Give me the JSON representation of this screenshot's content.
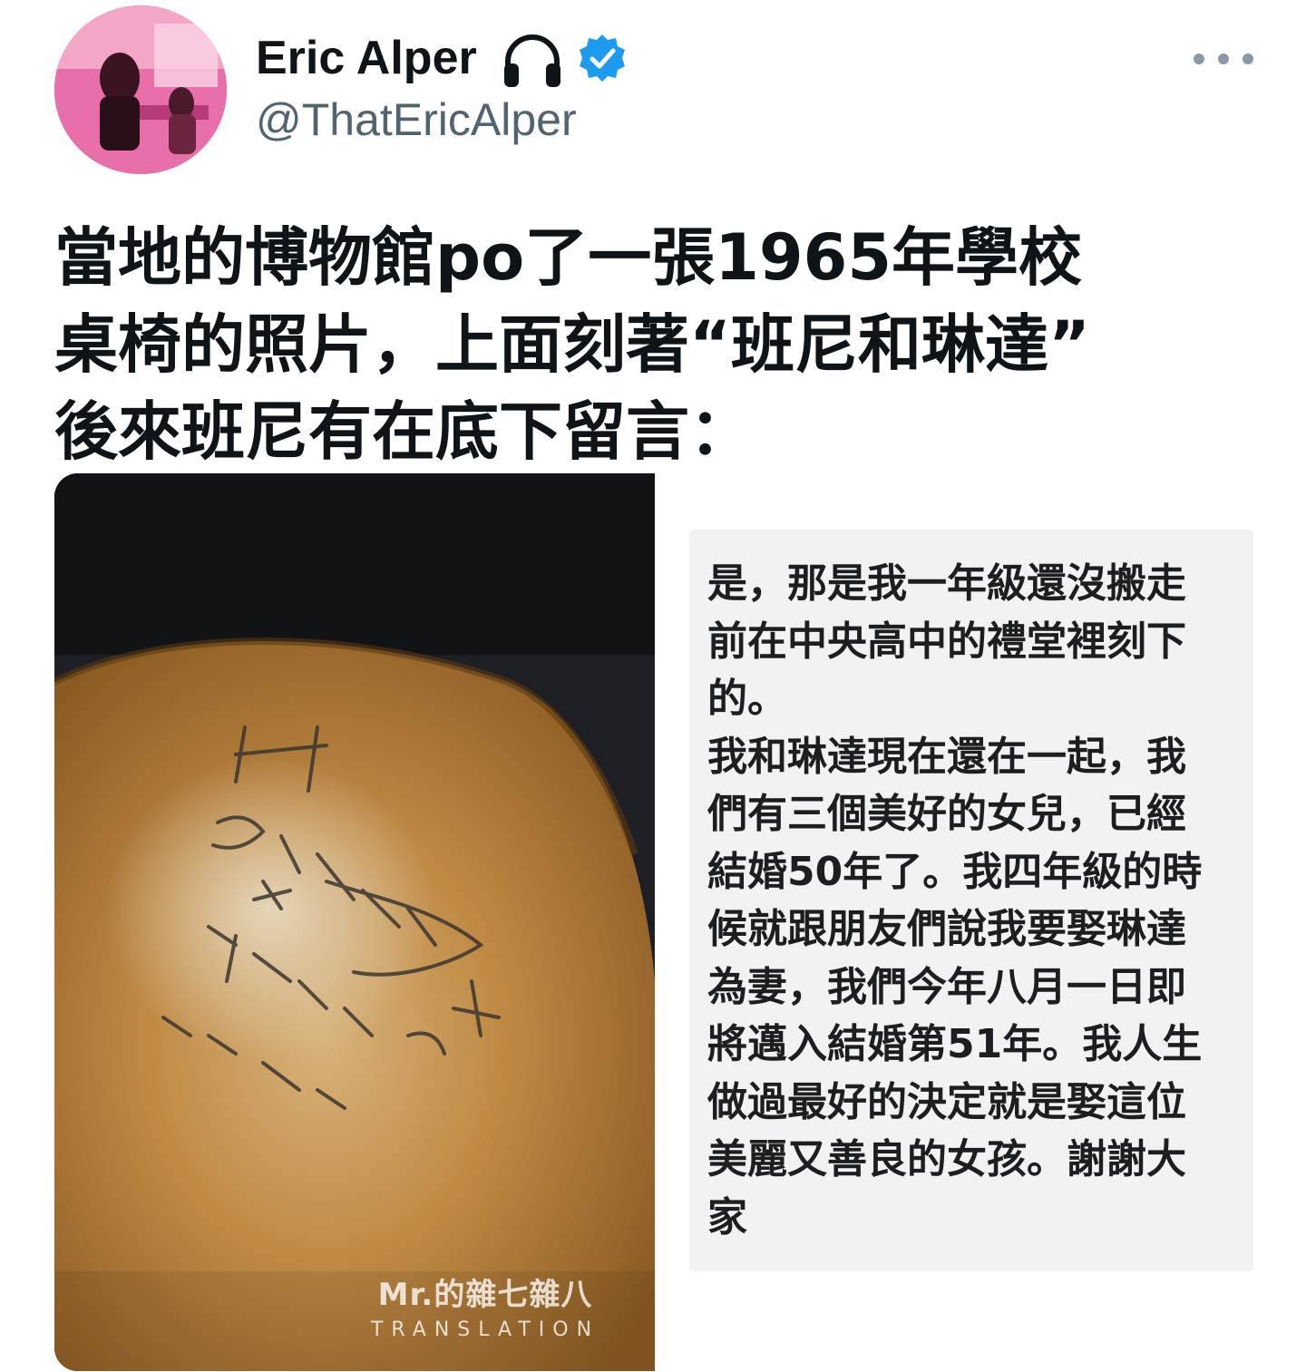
{
  "author": {
    "display_name": "Eric Alper",
    "handle": "@ThatEricAlper",
    "avatar_icon": "profile-photo",
    "badges": [
      "headphones-icon",
      "verified-icon"
    ],
    "verified_color": "#1d9bf0"
  },
  "more_icon": "more-dots-icon",
  "tweet": {
    "lines": [
      "當地的博物館po了一張1965年學校",
      "桌椅的照片，上面刻著“班尼和琳達”",
      "後來班尼有在底下留言："
    ]
  },
  "photo": {
    "watermark_brand": "Mr.的雜七雜八",
    "watermark_sub": "TRANSLATION"
  },
  "comment": {
    "lines": [
      "是，那是我一年級還沒搬走",
      "前在中央高中的禮堂裡刻下",
      "的。",
      "我和琳達現在還在一起，我",
      "們有三個美好的女兒，已經",
      "結婚50年了。我四年級的時",
      "候就跟朋友們說我要娶琳達",
      "為妻，我們今年八月一日即",
      "將邁入結婚第51年。我人生",
      "做過最好的決定就是娶這位",
      "美麗又善良的女孩。謝謝大",
      "家"
    ]
  }
}
